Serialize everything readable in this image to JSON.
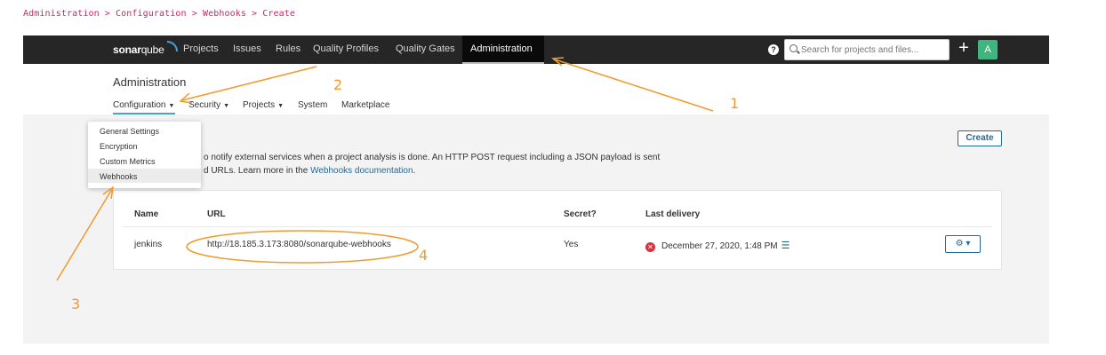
{
  "breadcrumb": "Administration > Configuration > Webhooks > Create",
  "navbar": {
    "logo_bold": "sonar",
    "logo_thin": "qube",
    "items": [
      "Projects",
      "Issues",
      "Rules",
      "Quality Profiles",
      "Quality Gates",
      "Administration"
    ],
    "active": "Administration",
    "help": "?",
    "search_placeholder": "Search for projects and files...",
    "plus": "+",
    "avatar": "A"
  },
  "admin": {
    "title": "Administration",
    "subnav": [
      "Configuration",
      "Security",
      "Projects",
      "System",
      "Marketplace"
    ]
  },
  "config_menu": [
    "General Settings",
    "Encryption",
    "Custom Metrics",
    "Webhooks"
  ],
  "description": {
    "line1": "o notify external services when a project analysis is done. An HTTP POST request including a JSON payload is sent",
    "line2_prefix": "d URLs. Learn more in the ",
    "link": "Webhooks documentation",
    "line2_suffix": "."
  },
  "create_label": "Create",
  "table": {
    "headers": [
      "Name",
      "URL",
      "Secret?",
      "Last delivery"
    ],
    "rows": [
      {
        "name": "jenkins",
        "url": "http://18.185.3.173:8080/sonarqube-webhooks",
        "secret": "Yes",
        "last_delivery": "December 27, 2020, 1:48 PM"
      }
    ]
  },
  "annotations": [
    "1",
    "2",
    "3",
    "4"
  ],
  "colors": {
    "annotation": "#f29a2e",
    "breadcrumb": "#c8266b",
    "navbar": "#262626",
    "link": "#236a97",
    "error": "#d4333f",
    "avatar": "#3fb67e"
  }
}
